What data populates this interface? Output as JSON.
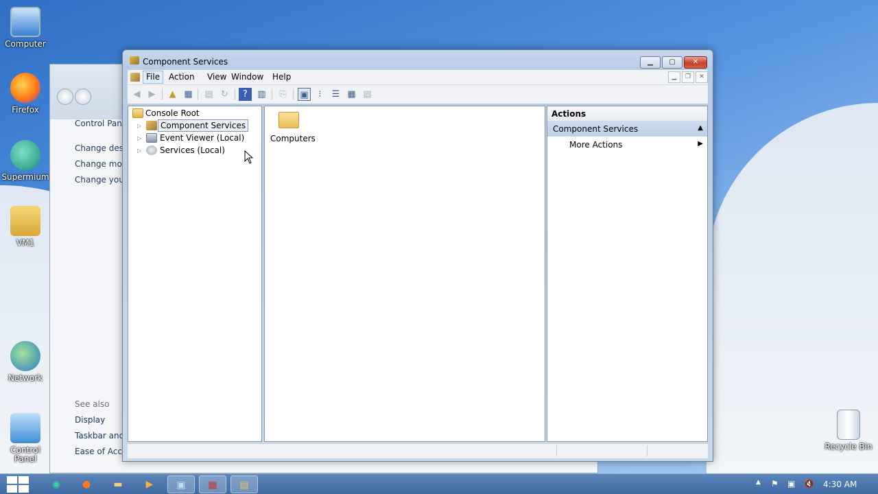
{
  "desktop": {
    "icons": [
      {
        "label": "Computer",
        "icon": "computer-icon"
      },
      {
        "label": "Firefox",
        "icon": "firefox-icon"
      },
      {
        "label": "Supermium",
        "icon": "supermium-icon"
      },
      {
        "label": "VM1",
        "icon": "user-folder-icon"
      },
      {
        "label": "Network",
        "icon": "network-icon"
      },
      {
        "label": "Control Panel",
        "icon": "control-panel-icon"
      },
      {
        "label": "Recycle Bin",
        "icon": "recycle-bin-icon"
      }
    ]
  },
  "control_panel": {
    "home": "Control Pane",
    "links": [
      "Change desk",
      "Change mou",
      "Change your"
    ],
    "see_also": "See also",
    "see_also_links": [
      "Display",
      "Taskbar and",
      "Ease of Acce"
    ]
  },
  "window": {
    "title": "Component Services",
    "menu": [
      "File",
      "Action",
      "View",
      "Window",
      "Help"
    ],
    "tree": {
      "root": "Console Root",
      "items": [
        "Component Services",
        "Event Viewer (Local)",
        "Services (Local)"
      ],
      "selected": "Component Services"
    },
    "content": {
      "items": [
        {
          "label": "Computers",
          "icon": "folder-icon"
        }
      ]
    },
    "actions": {
      "header": "Actions",
      "section": "Component Services",
      "items": [
        "More Actions"
      ]
    }
  },
  "taskbar": {
    "clock": "4:30 AM",
    "apps": [
      "supermium",
      "firefox",
      "explorer",
      "media-player",
      "control-panel",
      "toolbox",
      "component-services"
    ]
  },
  "colors": {
    "accent": "#3e6aa3",
    "actions_section_bg": "#bccfe6",
    "close_button": "#c4402a"
  }
}
